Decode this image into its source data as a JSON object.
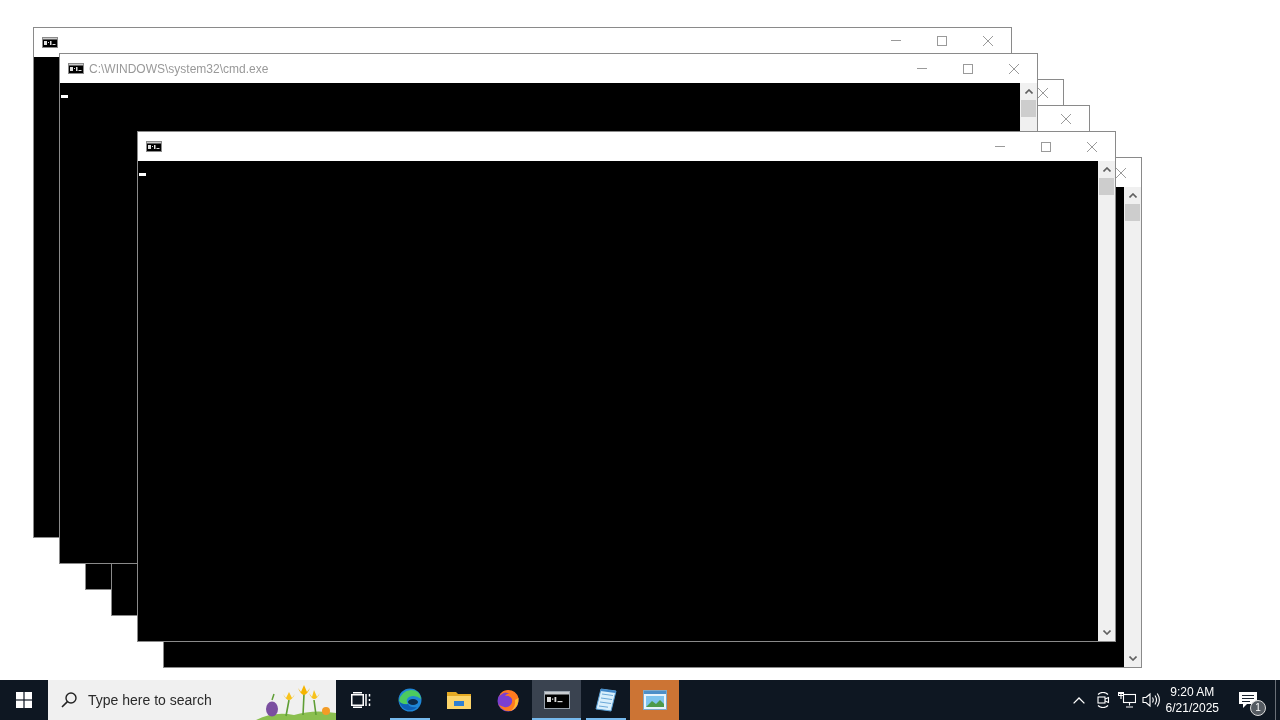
{
  "windows": [
    {
      "icon": true,
      "buttons": [
        {
          "kind": "minimize"
        },
        {
          "kind": "maximize"
        },
        {
          "kind": "close"
        }
      ],
      "cursor": false
    },
    {
      "icon": true,
      "title": "C:\\WINDOWS\\system32\\cmd.exe",
      "buttons": [
        {
          "kind": "minimize"
        },
        {
          "kind": "maximize"
        },
        {
          "kind": "close"
        }
      ],
      "scrollbar": true,
      "cursor": true
    },
    {
      "buttons": [
        {
          "kind": "close"
        }
      ]
    },
    {
      "buttons": [
        {
          "kind": "close"
        }
      ]
    },
    {
      "icon": true,
      "buttons": [
        {
          "kind": "minimize"
        },
        {
          "kind": "maximize"
        },
        {
          "kind": "close"
        }
      ],
      "scrollbar": true,
      "cursor": true
    },
    {
      "buttons": [
        {
          "kind": "close"
        }
      ],
      "scrollbar": true
    }
  ],
  "taskbar": {
    "search": {
      "placeholder": "Type here to search"
    },
    "apps": [
      {
        "kind": "swirl",
        "running": true,
        "selected": false,
        "flashing": false
      },
      {
        "kind": "folder",
        "running": false,
        "selected": false,
        "flashing": false
      },
      {
        "kind": "flame-globe",
        "running": false,
        "selected": false,
        "flashing": false
      },
      {
        "kind": "terminal",
        "running": true,
        "selected": true,
        "flashing": false
      },
      {
        "kind": "notepad",
        "running": true,
        "selected": false,
        "flashing": false
      },
      {
        "kind": "picture",
        "running": false,
        "selected": false,
        "flashing": true
      }
    ],
    "tray": {
      "time": "9:20 AM",
      "date": "6/21/2025",
      "notification_count": "1"
    }
  }
}
